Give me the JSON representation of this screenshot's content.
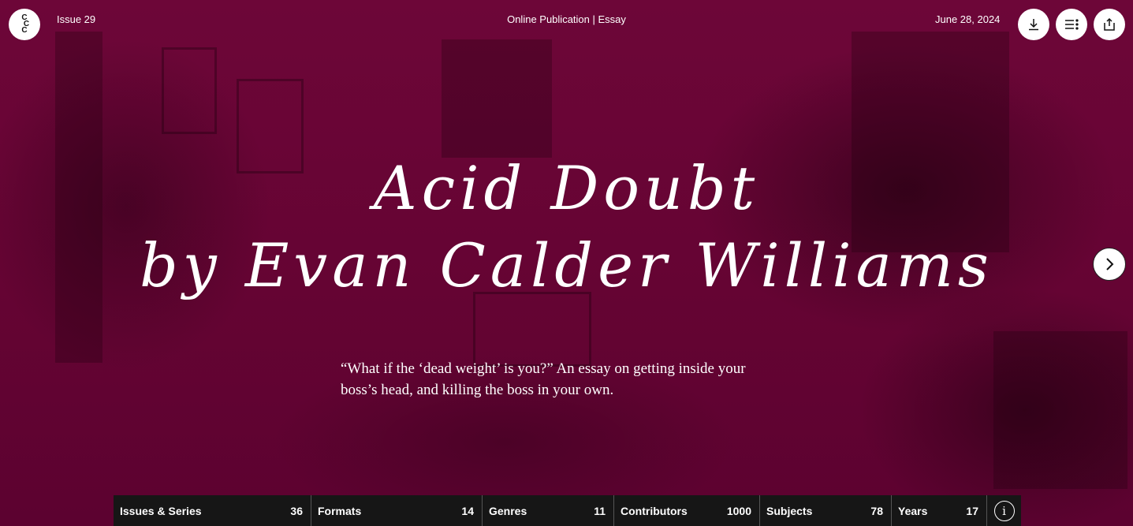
{
  "header": {
    "logo_text": [
      "C",
      "C",
      "C"
    ],
    "issue": "Issue 29",
    "publication_type": "Online Publication | Essay",
    "date": "June 28, 2024"
  },
  "actions": {
    "download_icon": "download-icon",
    "toc_icon": "table-of-contents-icon",
    "share_icon": "share-icon",
    "next_icon": "chevron-right-icon"
  },
  "hero": {
    "title_line1": "Acid Doubt",
    "title_line2": "by Evan Calder Williams",
    "dek": "“What if the ‘dead weight’ is you?” An essay on getting inside your boss’s head, and killing the boss in your own."
  },
  "filters": [
    {
      "label": "Issues & Series",
      "count": "36"
    },
    {
      "label": "Formats",
      "count": "14"
    },
    {
      "label": "Genres",
      "count": "11"
    },
    {
      "label": "Contributors",
      "count": "1000"
    },
    {
      "label": "Subjects",
      "count": "78"
    },
    {
      "label": "Years",
      "count": "17"
    }
  ],
  "info_label": "i",
  "colors": {
    "background": "#6a0535",
    "filter_bar": "#161616",
    "text": "#ffffff"
  }
}
